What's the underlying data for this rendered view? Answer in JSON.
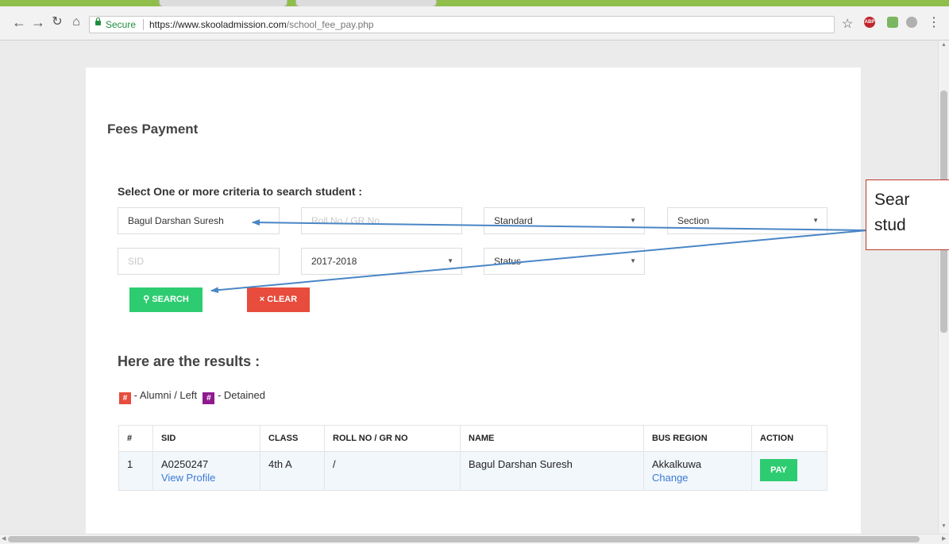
{
  "browser": {
    "secure_label": "Secure",
    "url_host": "https://www.skooladmission.com",
    "url_path": "/school_fee_pay.php",
    "ext_abp_label": "ABP"
  },
  "page": {
    "title": "Fees Payment",
    "criteria_heading": "Select One or more criteria to search student :",
    "fields": {
      "name_value": "Bagul Darshan Suresh",
      "roll_placeholder": "Roll No / GR No",
      "standard_selected": "Standard",
      "section_selected": "Section",
      "sid_placeholder": "SID",
      "year_selected": "2017-2018",
      "status_selected": "Status"
    },
    "buttons": {
      "search_label": "SEARCH",
      "clear_label": "CLEAR"
    },
    "results_heading": "Here are the results :",
    "legend": {
      "alumni_badge": "#",
      "alumni_label": "- Alumni / Left",
      "detained_badge": "#",
      "detained_label": "- Detained"
    },
    "table": {
      "headers": [
        "#",
        "SID",
        "CLASS",
        "ROLL NO / GR NO",
        "NAME",
        "BUS REGION",
        "ACTION"
      ],
      "rows": [
        {
          "index": "1",
          "sid": "A0250247",
          "view_profile": "View Profile",
          "class": "4th A",
          "roll": "/",
          "name": "Bagul Darshan Suresh",
          "bus_region": "Akkalkuwa",
          "change": "Change",
          "action": "PAY"
        }
      ]
    }
  },
  "callout": {
    "line1": "Sear",
    "line2": "stud",
    "border_color": "#c0392b",
    "arrow_color": "#4a86c5"
  }
}
